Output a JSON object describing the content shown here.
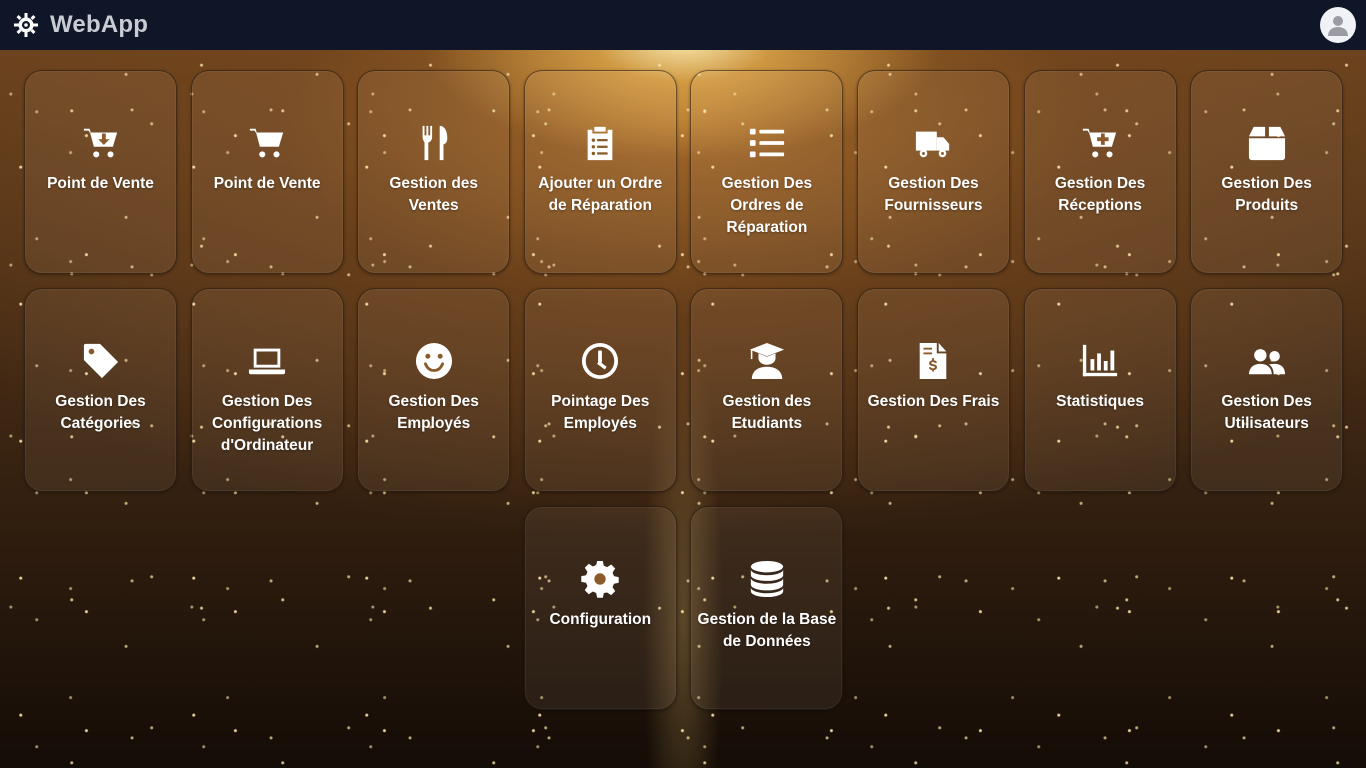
{
  "app": {
    "name": "WebApp"
  },
  "colors": {
    "topbar": "#0f1628",
    "accent": "#c9a060",
    "tile_text": "#ffffff"
  },
  "header": {
    "logo_icon": "gear-chip-icon",
    "avatar_icon": "user-icon"
  },
  "tiles": [
    {
      "label": "Point de Vente",
      "icon": "cart-arrow-down-icon"
    },
    {
      "label": "Point de Vente",
      "icon": "shopping-cart-icon"
    },
    {
      "label": "Gestion des Ventes",
      "icon": "utensils-icon"
    },
    {
      "label": "Ajouter un Ordre de Réparation",
      "icon": "clipboard-list-icon"
    },
    {
      "label": "Gestion Des Ordres de Réparation",
      "icon": "list-icon"
    },
    {
      "label": "Gestion Des Fournisseurs",
      "icon": "truck-icon"
    },
    {
      "label": "Gestion Des Réceptions",
      "icon": "cart-plus-icon"
    },
    {
      "label": "Gestion Des Produits",
      "icon": "box-icon"
    },
    {
      "label": "Gestion Des Catégories",
      "icon": "tag-icon"
    },
    {
      "label": "Gestion Des Configurations d'Ordinateur",
      "icon": "laptop-icon"
    },
    {
      "label": "Gestion Des Employés",
      "icon": "smile-icon"
    },
    {
      "label": "Pointage Des Employés",
      "icon": "clock-icon"
    },
    {
      "label": "Gestion des Etudiants",
      "icon": "graduate-icon"
    },
    {
      "label": "Gestion Des Frais",
      "icon": "invoice-dollar-icon"
    },
    {
      "label": "Statistiques",
      "icon": "chart-bar-icon"
    },
    {
      "label": "Gestion Des Utilisateurs",
      "icon": "users-icon"
    },
    {
      "label": "Configuration",
      "icon": "cog-icon"
    },
    {
      "label": "Gestion de la Base de Données",
      "icon": "database-icon"
    }
  ]
}
